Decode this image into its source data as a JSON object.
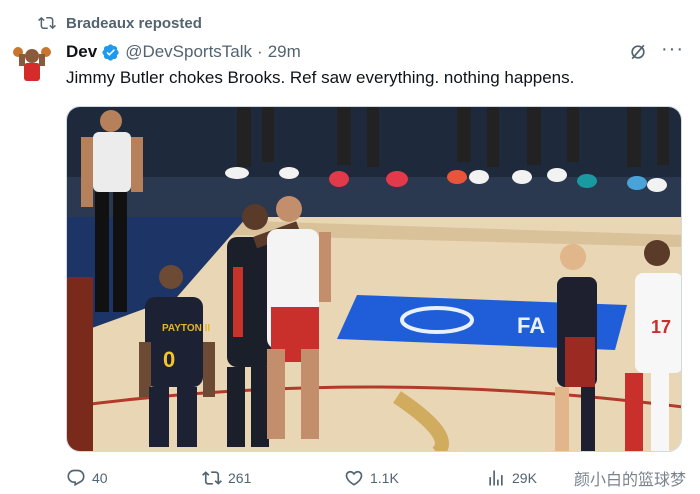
{
  "repost": {
    "label": "Bradeaux reposted",
    "icon": "repost-icon"
  },
  "author": {
    "name": "Dev",
    "handle": "@DevSportsTalk",
    "separator": "·",
    "time": "29m",
    "verified_color": "#1d9bf0"
  },
  "tweet": {
    "text": "Jimmy Butler chokes Brooks. Ref saw everything. nothing happens."
  },
  "media": {
    "alt_scene": "basketball-court-altercation",
    "court_text": "FA",
    "jersey_number": "0",
    "jersey_name": "PAYTON II",
    "jersey_number_right": "17"
  },
  "actions": {
    "replies": "40",
    "reposts": "261",
    "likes": "1.1K",
    "views": "29K"
  },
  "watermark": "颜小白的篮球梦",
  "colors": {
    "text": "#0f1419",
    "muted": "#536471",
    "court_blue": "#1f5ed8"
  }
}
